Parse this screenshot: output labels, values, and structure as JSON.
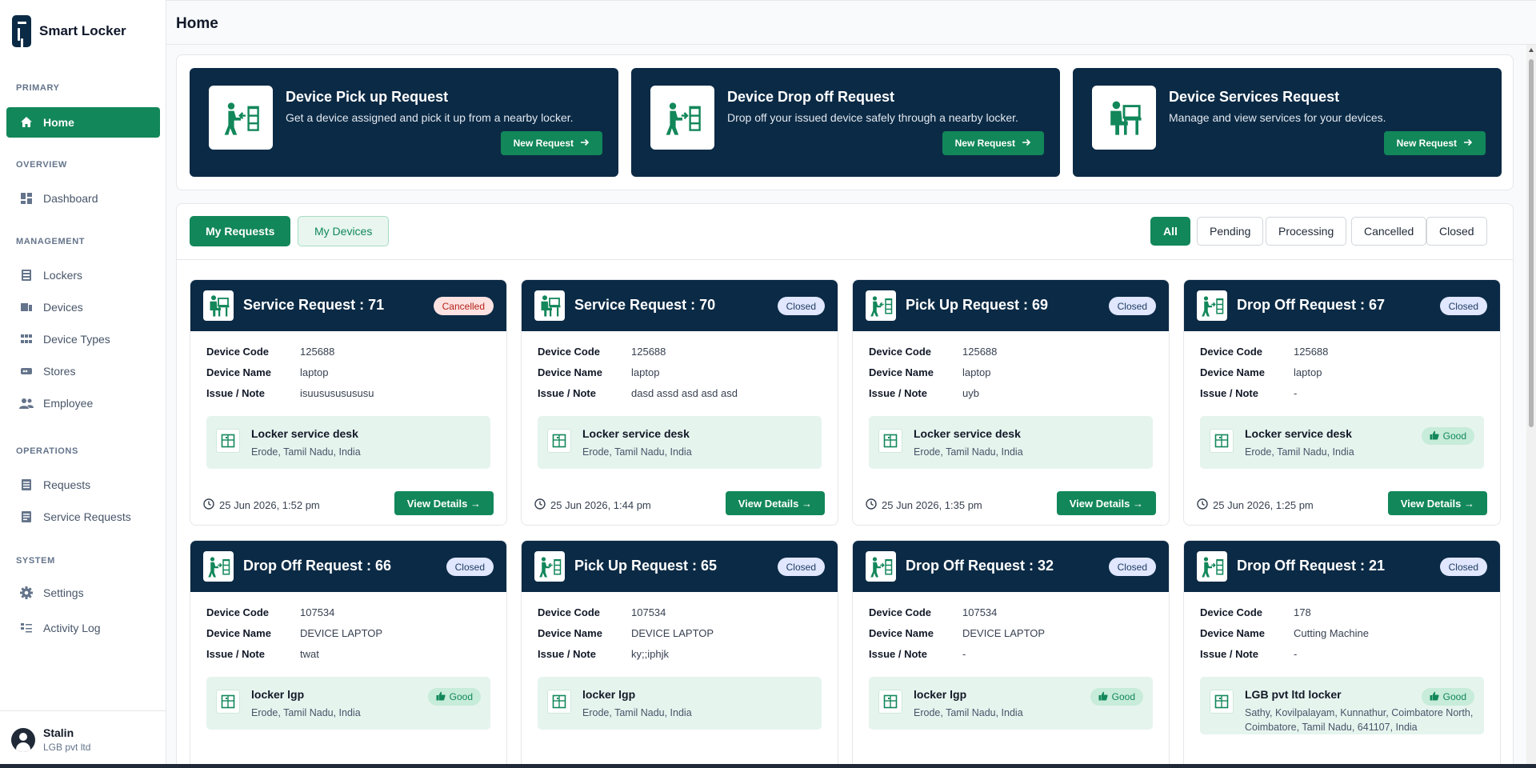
{
  "app": {
    "name": "Smart Locker"
  },
  "header": {
    "title": "Home"
  },
  "sidebar": {
    "sections": [
      {
        "title": "PRIMARY",
        "items": [
          {
            "label": "Home",
            "icon": "home-icon",
            "active": true
          }
        ]
      },
      {
        "title": "OVERVIEW",
        "items": [
          {
            "label": "Dashboard",
            "icon": "dashboard-icon"
          }
        ]
      },
      {
        "title": "MANAGEMENT",
        "items": [
          {
            "label": "Lockers",
            "icon": "lockers-icon"
          },
          {
            "label": "Devices",
            "icon": "devices-icon"
          },
          {
            "label": "Device Types",
            "icon": "grid-icon"
          },
          {
            "label": "Stores",
            "icon": "store-icon"
          },
          {
            "label": "Employee",
            "icon": "employee-icon"
          }
        ]
      },
      {
        "title": "OPERATIONS",
        "items": [
          {
            "label": "Requests",
            "icon": "list-icon"
          },
          {
            "label": "Service Requests",
            "icon": "document-icon"
          }
        ]
      },
      {
        "title": "SYSTEM",
        "items": [
          {
            "label": "Settings",
            "icon": "gear-icon"
          },
          {
            "label": "Activity Log",
            "icon": "activity-log-icon"
          }
        ]
      }
    ]
  },
  "user": {
    "name": "Stalin",
    "org": "LGB pvt ltd"
  },
  "quick_actions": [
    {
      "title": "Device Pick up Request",
      "desc": "Get a device assigned and pick it up from a nearby locker.",
      "button": "New Request",
      "icon": "pickup-icon"
    },
    {
      "title": "Device Drop off Request",
      "desc": "Drop off your issued device safely through a nearby locker.",
      "button": "New Request",
      "icon": "dropoff-icon"
    },
    {
      "title": "Device Services Request",
      "desc": "Manage and view services for your devices.",
      "button": "New Request",
      "icon": "service-icon"
    }
  ],
  "tabs": {
    "my_requests": "My Requests",
    "my_devices": "My Devices"
  },
  "filters": [
    "All",
    "Pending",
    "Processing",
    "Cancelled",
    "Closed"
  ],
  "labels": {
    "device_code": "Device Code",
    "device_name": "Device Name",
    "issue_note": "Issue / Note",
    "view_details": "View Details →",
    "good": "Good"
  },
  "cards": [
    {
      "title": "Service Request : 71",
      "status": "Cancelled",
      "type": "service",
      "code": "125688",
      "name": "laptop",
      "note": "isuusususususu",
      "locker": "Locker service desk",
      "address": "Erode, Tamil Nadu, India",
      "condition": "",
      "time": "25 Jun 2026, 1:52 pm"
    },
    {
      "title": "Service Request : 70",
      "status": "Closed",
      "type": "service",
      "code": "125688",
      "name": "laptop",
      "note": "dasd assd asd asd asd",
      "locker": "Locker service desk",
      "address": "Erode, Tamil Nadu, India",
      "condition": "",
      "time": "25 Jun 2026, 1:44 pm"
    },
    {
      "title": "Pick Up Request : 69",
      "status": "Closed",
      "type": "pickup",
      "code": "125688",
      "name": "laptop",
      "note": "uyb",
      "locker": "Locker service desk",
      "address": "Erode, Tamil Nadu, India",
      "condition": "",
      "time": "25 Jun 2026, 1:35 pm"
    },
    {
      "title": "Drop Off Request : 67",
      "status": "Closed",
      "type": "dropoff",
      "code": "125688",
      "name": "laptop",
      "note": "-",
      "locker": "Locker service desk",
      "address": "Erode, Tamil Nadu, India",
      "condition": "Good",
      "time": "25 Jun 2026, 1:25 pm"
    },
    {
      "title": "Drop Off Request : 66",
      "status": "Closed",
      "type": "dropoff",
      "code": "107534",
      "name": "DEVICE LAPTOP",
      "note": "twat",
      "locker": "locker lgp",
      "address": "Erode, Tamil Nadu, India",
      "condition": "Good",
      "time": ""
    },
    {
      "title": "Pick Up Request : 65",
      "status": "Closed",
      "type": "pickup",
      "code": "107534",
      "name": "DEVICE LAPTOP",
      "note": "ky;;iphjk",
      "locker": "locker lgp",
      "address": "Erode, Tamil Nadu, India",
      "condition": "",
      "time": ""
    },
    {
      "title": "Drop Off Request : 32",
      "status": "Closed",
      "type": "dropoff",
      "code": "107534",
      "name": "DEVICE LAPTOP",
      "note": "-",
      "locker": "locker lgp",
      "address": "Erode, Tamil Nadu, India",
      "condition": "Good",
      "time": ""
    },
    {
      "title": "Drop Off Request : 21",
      "status": "Closed",
      "type": "dropoff",
      "code": "178",
      "name": "Cutting Machine",
      "note": "-",
      "locker": "LGB pvt ltd locker",
      "address": "Sathy, Kovilpalayam, Kunnathur, Coimbatore North, Coimbatore, Tamil Nadu, 641107, India",
      "condition": "Good",
      "time": ""
    }
  ],
  "colors": {
    "navy": "#0b2a45",
    "green": "#12875a"
  }
}
